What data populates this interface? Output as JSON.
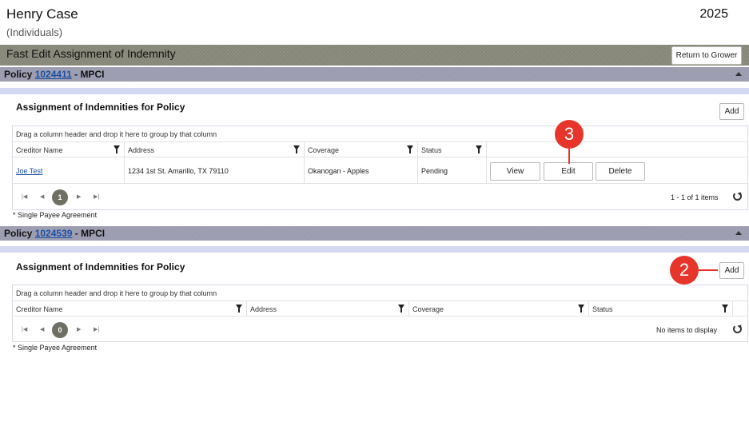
{
  "header": {
    "name": "Henry Case",
    "subtitle": "(Individuals)",
    "year": "2025"
  },
  "titlebar": {
    "title": "Fast Edit Assignment of Indemnity",
    "return_label": "Return to Grower"
  },
  "policies": [
    {
      "prefix": "Policy",
      "number": "1024411",
      "suffix": "- MPCI",
      "section_title": "Assignment of Indemnities for Policy",
      "add_label": "Add",
      "group_hint": "Drag a column header and drop it here to group by that column",
      "columns": [
        "Creditor Name",
        "Address",
        "Coverage",
        "Status"
      ],
      "rows": [
        {
          "creditor": "Joe Test",
          "address": "1234 1st St. Amarillo, TX 79110",
          "coverage": "Okanogan - Apples",
          "status": "Pending",
          "actions": [
            "View",
            "Edit",
            "Delete"
          ]
        }
      ],
      "page": "1",
      "pager_info": "1 - 1 of 1 items",
      "note": "* Single Payee Agreement"
    },
    {
      "prefix": "Policy",
      "number": "1024539",
      "suffix": "- MPCI",
      "section_title": "Assignment of Indemnities for Policy",
      "add_label": "Add",
      "group_hint": "Drag a column header and drop it here to group by that column",
      "columns": [
        "Creditor Name",
        "Address",
        "Coverage",
        "Status"
      ],
      "rows": [],
      "page": "0",
      "pager_info": "No items to display",
      "note": "* Single Payee Agreement"
    }
  ],
  "annotations": {
    "badge_edit": "3",
    "badge_add": "2"
  },
  "icons": {
    "filter": "filter-icon",
    "first": "first-page-icon",
    "prev": "prev-page-icon",
    "next": "next-page-icon",
    "last": "last-page-icon",
    "refresh": "refresh-icon",
    "collapse": "collapse-icon"
  },
  "colors": {
    "titlebar": "#8a8a7c",
    "policybar": "#9b9bb0",
    "stripe": "#d4d8f0",
    "badge": "#e8352b",
    "link": "#1a4fa3",
    "page_current": "#6f6f64"
  }
}
